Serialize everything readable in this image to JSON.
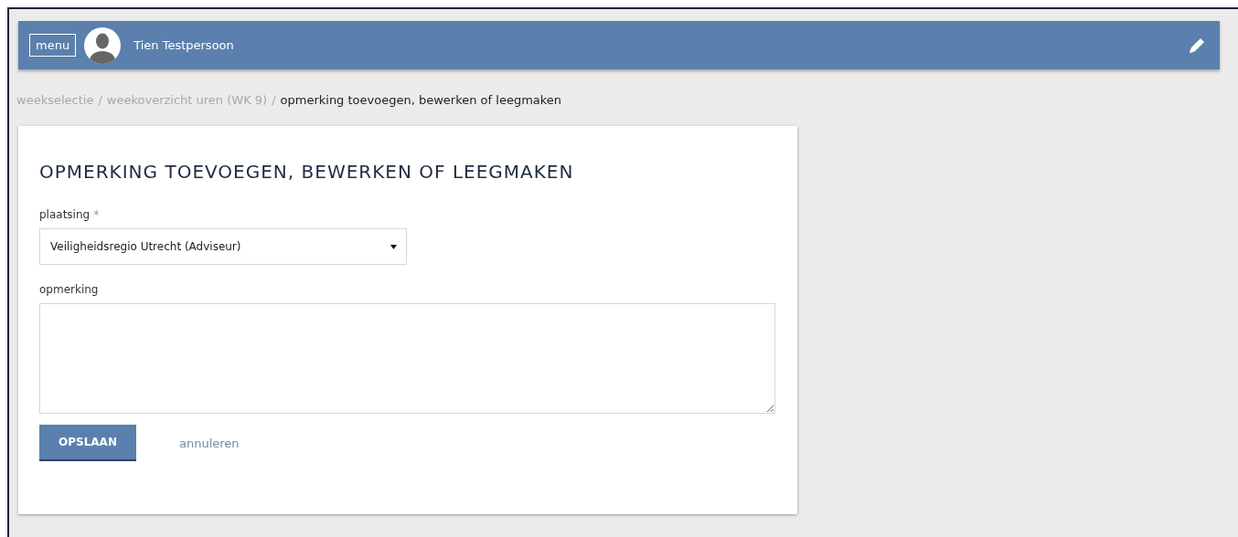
{
  "header": {
    "menu_label": "menu",
    "user_name": "Tien Testpersoon"
  },
  "breadcrumb": {
    "separator": "/",
    "items": [
      {
        "label": "weekselectie",
        "current": false
      },
      {
        "label": "weekoverzicht uren (WK 9)",
        "current": false
      },
      {
        "label": "opmerking toevoegen, bewerken of leegmaken",
        "current": true
      }
    ]
  },
  "form": {
    "title": "OPMERKING TOEVOEGEN, BEWERKEN OF LEEGMAKEN",
    "fields": [
      {
        "kind": "select",
        "label": "plaatsing",
        "required_mark": "*",
        "value": "Veiligheidsregio Utrecht (Adviseur)"
      },
      {
        "kind": "textarea",
        "label": "opmerking"
      }
    ],
    "save_button": "OPSLAAN",
    "cancel_link": "annuleren"
  }
}
